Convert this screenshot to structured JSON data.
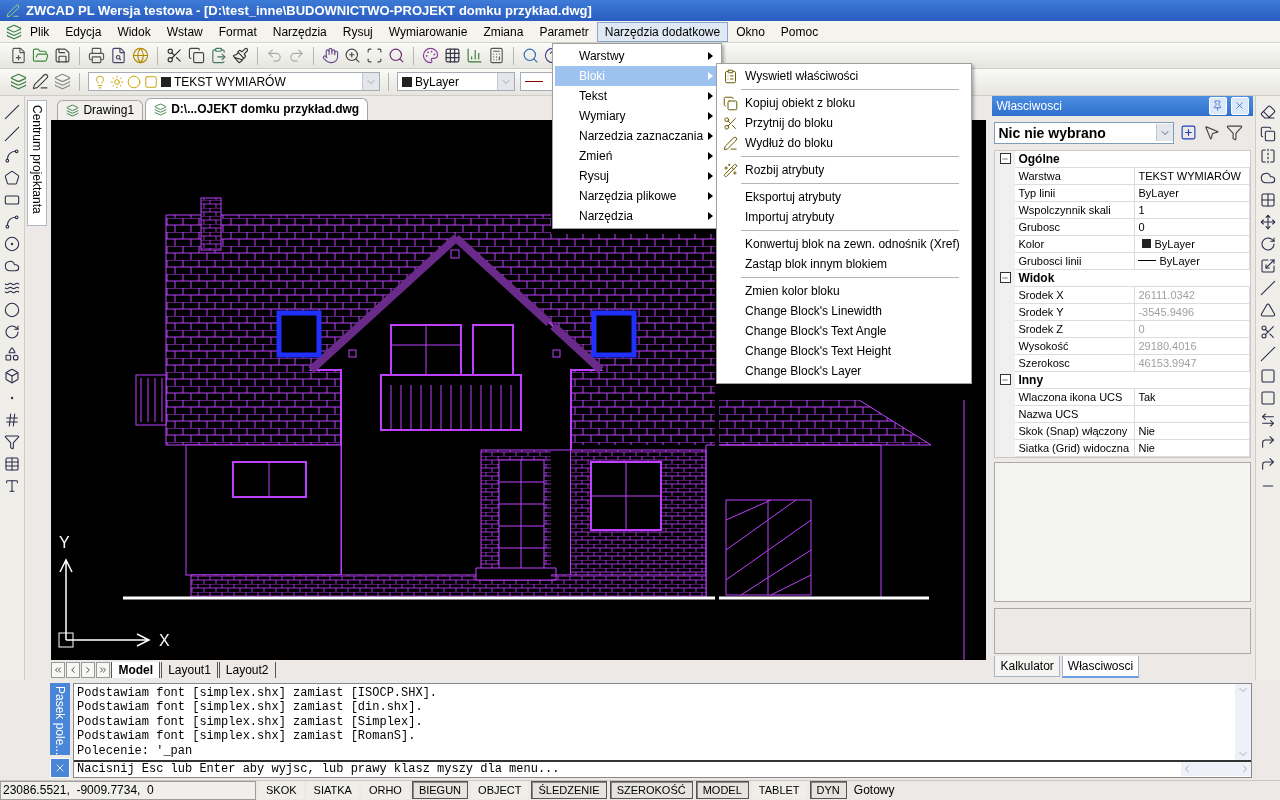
{
  "window": {
    "title": "ZWCAD PL Wersja testowa - [D:\\test_inne\\BUDOWNICTWO-PROJEKT domku przykład.dwg]"
  },
  "menu_bar": [
    {
      "label": "Plik",
      "selected": false
    },
    {
      "label": "Edycja",
      "selected": false
    },
    {
      "label": "Widok",
      "selected": false
    },
    {
      "label": "Wstaw",
      "selected": false
    },
    {
      "label": "Format",
      "selected": false
    },
    {
      "label": "Narzędzia",
      "selected": false
    },
    {
      "label": "Rysuj",
      "selected": false
    },
    {
      "label": "Wymiarowanie",
      "selected": false
    },
    {
      "label": "Zmiana",
      "selected": false
    },
    {
      "label": "Parametr",
      "selected": false
    },
    {
      "label": "Narzędzia dodatkowe",
      "selected": true
    },
    {
      "label": "Okno",
      "selected": false
    },
    {
      "label": "Pomoc",
      "selected": false
    }
  ],
  "open_menu": [
    {
      "label": "Warstwy",
      "selected": false
    },
    {
      "label": "Bloki",
      "selected": true
    },
    {
      "label": "Tekst",
      "selected": false
    },
    {
      "label": "Wymiary",
      "selected": false
    },
    {
      "label": "Narzedzia zaznaczania",
      "selected": false
    },
    {
      "label": "Zmień",
      "selected": false
    },
    {
      "label": "Rysuj",
      "selected": false
    },
    {
      "label": "Narzędzia plikowe",
      "selected": false
    },
    {
      "label": "Narzędzia",
      "selected": false
    }
  ],
  "submenu": [
    [
      {
        "label": "Wyswietl właściwości",
        "kind": "icon"
      }
    ],
    [
      {
        "label": "Kopiuj obiekt z bloku",
        "kind": "icon"
      },
      {
        "label": "Przytnij do bloku",
        "kind": "icon"
      },
      {
        "label": "Wydłuż do bloku",
        "kind": "icon"
      }
    ],
    [
      {
        "label": "Rozbij atrybuty",
        "kind": "icon"
      }
    ],
    [
      {
        "label": "Eksportuj atrybuty",
        "kind": "plain"
      },
      {
        "label": "Importuj atrybuty",
        "kind": "plain"
      }
    ],
    [
      {
        "label": "Konwertuj blok na zewn. odnośnik (Xref)",
        "kind": "plain"
      },
      {
        "label": "Zastąp blok innym blokiem",
        "kind": "plain"
      }
    ],
    [
      {
        "label": "Zmien kolor bloku",
        "kind": "plain"
      },
      {
        "label": "Change Block's Linewidth",
        "kind": "plain"
      },
      {
        "label": "Change Block's Text Angle",
        "kind": "plain"
      },
      {
        "label": "Change Block's Text Height",
        "kind": "plain"
      },
      {
        "label": "Change Block's Layer",
        "kind": "plain"
      }
    ]
  ],
  "layer_toolbar": {
    "layer": "TEKST WYMIARÓW",
    "color_label": "ByLayer"
  },
  "document_tabs": [
    {
      "label": "Drawing1",
      "selected": false
    },
    {
      "label": "D:\\...OJEKT domku przykład.dwg",
      "selected": true
    }
  ],
  "side_tab": "Centrum projektanta",
  "drawing": {
    "y_axis": "Y",
    "x_axis": "X"
  },
  "layout_tabs": [
    {
      "label": "Model",
      "selected": true
    },
    {
      "label": "Layout1",
      "selected": false
    },
    {
      "label": "Layout2",
      "selected": false
    }
  ],
  "properties": {
    "title": "Własciwosci",
    "selection": "Nic nie wybrano",
    "sections": [
      {
        "name": "Ogólne",
        "expanded": true,
        "rows": [
          {
            "name": "Warstwa",
            "value": "TEKST WYMIARÓW",
            "kind": "text",
            "readonly": false
          },
          {
            "name": "Typ linii",
            "value": "ByLayer",
            "kind": "text",
            "readonly": false
          },
          {
            "name": "Wspolczynnik skali",
            "value": "1",
            "kind": "text",
            "readonly": false
          },
          {
            "name": "Grubosc",
            "value": "0",
            "kind": "text",
            "readonly": false
          },
          {
            "name": "Kolor",
            "value": "ByLayer",
            "kind": "color",
            "readonly": false
          },
          {
            "name": "Grubosci linii",
            "value": "ByLayer",
            "kind": "lineweight",
            "readonly": false
          }
        ]
      },
      {
        "name": "Widok",
        "expanded": true,
        "rows": [
          {
            "name": "Srodek X",
            "value": "26111.0342",
            "kind": "text",
            "readonly": true
          },
          {
            "name": "Srodek Y",
            "value": "-3545.9496",
            "kind": "text",
            "readonly": true
          },
          {
            "name": "Srodek Z",
            "value": "0",
            "kind": "text",
            "readonly": true
          },
          {
            "name": "Wysokość",
            "value": "29180.4016",
            "kind": "text",
            "readonly": true
          },
          {
            "name": "Szerokosc",
            "value": "46153.9947",
            "kind": "text",
            "readonly": true
          }
        ]
      },
      {
        "name": "Inny",
        "expanded": true,
        "rows": [
          {
            "name": "Wlaczona ikona UCS",
            "value": "Tak",
            "kind": "text",
            "readonly": false
          },
          {
            "name": "Nazwa UCS",
            "kind": "text",
            "readonly": false
          },
          {
            "name": "Skok (Snap) włączony",
            "value": "Nie",
            "kind": "text",
            "readonly": false
          },
          {
            "name": "Siatka (Grid) widoczna",
            "value": "Nie",
            "kind": "text",
            "readonly": false
          }
        ]
      }
    ]
  },
  "panel_tabs": [
    {
      "label": "Kalkulator",
      "selected": false
    },
    {
      "label": "Własciwosci",
      "selected": true
    }
  ],
  "command": {
    "label": "Pasek pole...",
    "history": [
      "Podstawiam font [simplex.shx] zamiast [ISOCP.SHX].",
      "Podstawiam font [simplex.shx] zamiast [din.shx].",
      "Podstawiam font [simplex.shx] zamiast [Simplex].",
      "Podstawiam font [simplex.shx] zamiast [RomanS].",
      "Polecenie: '_pan"
    ],
    "prompt": "Nacisnij Esc lub Enter aby wyjsc, lub prawy klasz myszy dla menu..."
  },
  "status_bar": {
    "coordinates": "23086.5521,  -9009.7734,  0",
    "toggles": [
      {
        "label": "SKOK",
        "on": false
      },
      {
        "label": "SIATKA",
        "on": false
      },
      {
        "label": "ORHO",
        "on": false
      },
      {
        "label": "BIEGUN",
        "on": true
      },
      {
        "label": "OBJECT",
        "on": false
      },
      {
        "label": "ŚLEDZENIE",
        "on": true
      },
      {
        "label": "SZEROKOŚĆ",
        "on": true
      },
      {
        "label": "MODEL",
        "on": true
      },
      {
        "label": "TABLET",
        "on": false
      },
      {
        "label": "DYN",
        "on": true
      }
    ],
    "status": "Gotowy"
  }
}
